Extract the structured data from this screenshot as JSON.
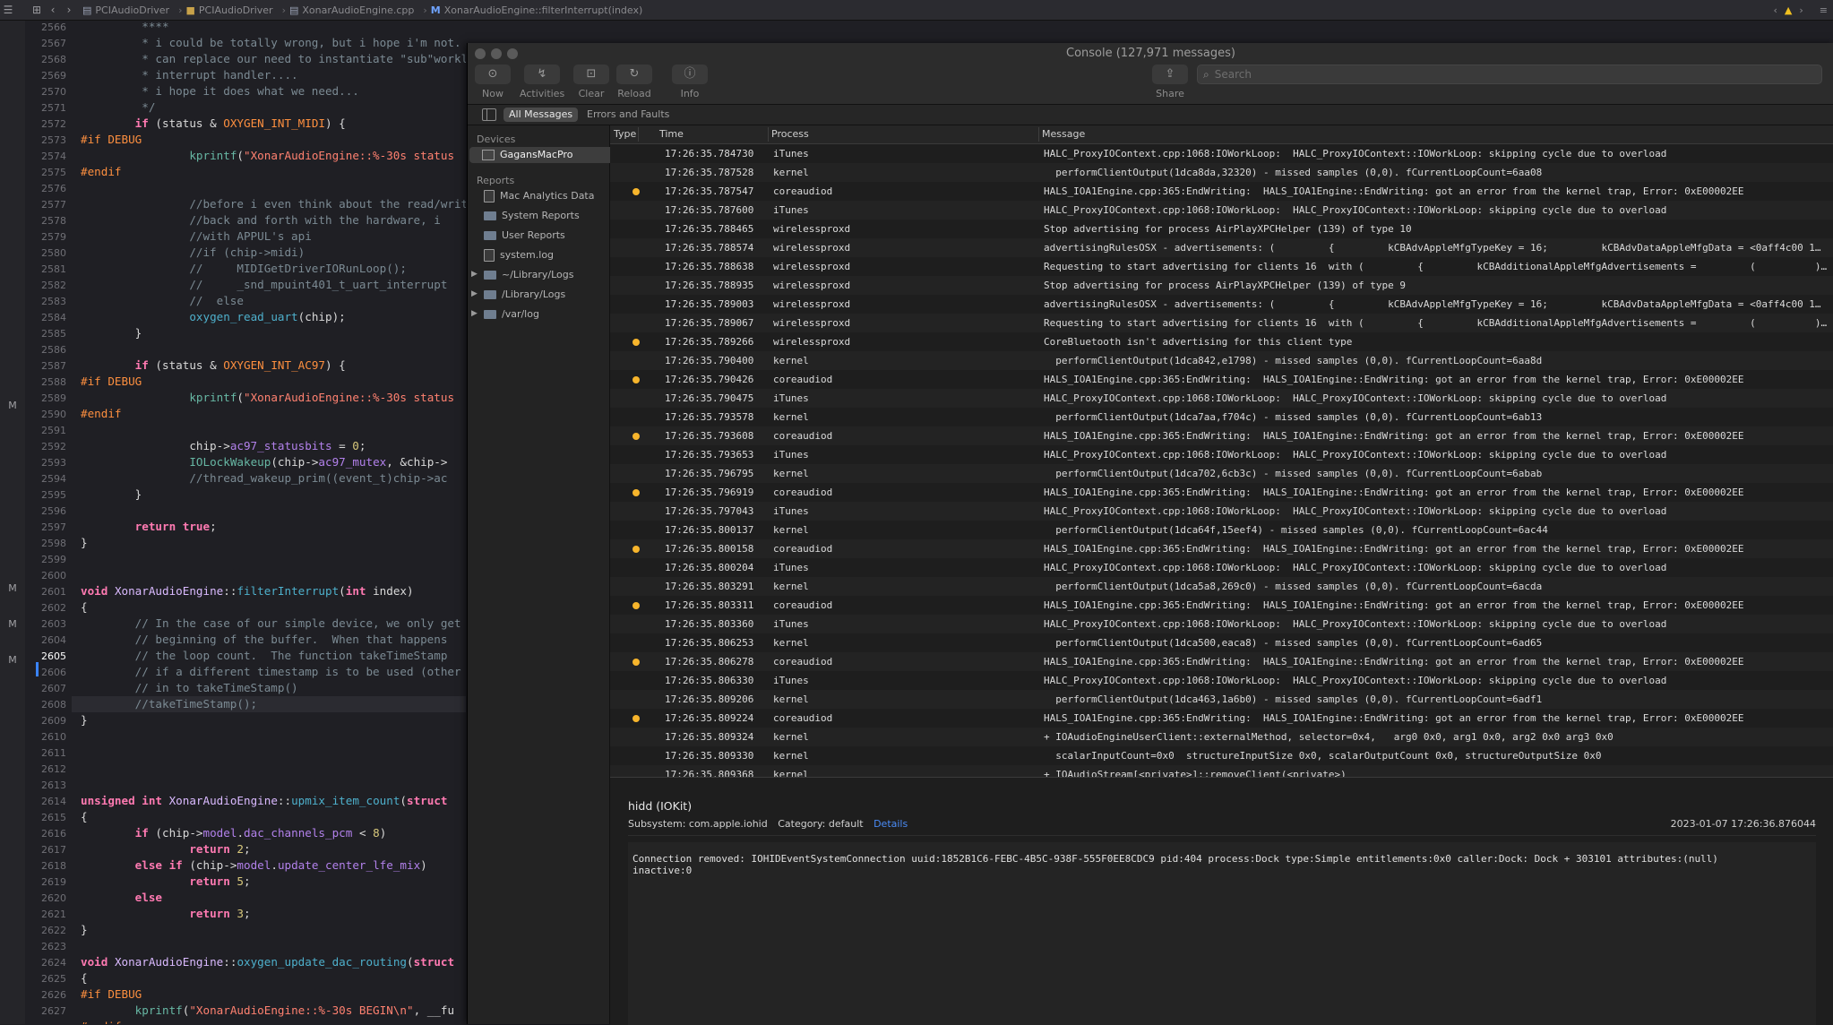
{
  "xcode": {
    "breadcrumbs": [
      "PCIAudioDriver",
      "PCIAudioDriver",
      "XonarAudioEngine.cpp",
      "XonarAudioEngine::filterInterrupt(index)"
    ],
    "gutter_markers": [
      "M",
      "M",
      "M",
      "M"
    ],
    "current_line": "2605",
    "line_numbers": [
      "2566",
      "2567",
      "2568",
      "2569",
      "2570",
      "2571",
      "2572",
      "2573",
      "2574",
      "2575",
      "2576",
      "2577",
      "2578",
      "2579",
      "2580",
      "2581",
      "2582",
      "2583",
      "2584",
      "2585",
      "2586",
      "2587",
      "2588",
      "2589",
      "2590",
      "2591",
      "2592",
      "2593",
      "2594",
      "2595",
      "2596",
      "2597",
      "2598",
      "2599",
      "2600",
      "2601",
      "2602",
      "2603",
      "2604",
      "2605",
      "2606",
      "2607",
      "2608",
      "2609",
      "2610",
      "2611",
      "2612",
      "2613",
      "2614",
      "2615",
      "2616",
      "2617",
      "2618",
      "2619",
      "2620",
      "2621",
      "2622",
      "2623",
      "2624",
      "2625",
      "2626",
      "2627"
    ]
  },
  "console": {
    "title": "Console (127,971 messages)",
    "toolbar": {
      "now": "Now",
      "activities": "Activities",
      "clear": "Clear",
      "reload": "Reload",
      "info": "Info",
      "share": "Share",
      "search_placeholder": "Search"
    },
    "filters": {
      "all_messages": "All Messages",
      "errors_and_faults": "Errors and Faults"
    },
    "sidebar": {
      "devices_header": "Devices",
      "device": "GagansMacPro",
      "reports_header": "Reports",
      "reports": [
        "Mac Analytics Data",
        "System Reports",
        "User Reports",
        "system.log",
        "~/Library/Logs",
        "/Library/Logs",
        "/var/log"
      ]
    },
    "columns": {
      "type": "Type",
      "time": "Time",
      "process": "Process",
      "message": "Message"
    },
    "rows": [
      {
        "dot": false,
        "time": "17:26:35.784730",
        "process": "iTunes",
        "message": "HALC_ProxyIOContext.cpp:1068:IOWorkLoop:  HALC_ProxyIOContext::IOWorkLoop: skipping cycle due to overload"
      },
      {
        "dot": false,
        "time": "17:26:35.787528",
        "process": "kernel",
        "message": "  performClientOutput(1dca8da,32320) - missed samples (0,0). fCurrentLoopCount=6aa08"
      },
      {
        "dot": true,
        "time": "17:26:35.787547",
        "process": "coreaudiod",
        "message": "HALS_IOA1Engine.cpp:365:EndWriting:  HALS_IOA1Engine::EndWriting: got an error from the kernel trap, Error: 0xE00002EE"
      },
      {
        "dot": false,
        "time": "17:26:35.787600",
        "process": "iTunes",
        "message": "HALC_ProxyIOContext.cpp:1068:IOWorkLoop:  HALC_ProxyIOContext::IOWorkLoop: skipping cycle due to overload"
      },
      {
        "dot": false,
        "time": "17:26:35.788465",
        "process": "wirelessproxd",
        "message": "Stop advertising for process AirPlayXPCHelper (139) of type 10"
      },
      {
        "dot": false,
        "time": "17:26:35.788574",
        "process": "wirelessproxd",
        "message": "advertisingRulesOSX - advertisements: (         {         kCBAdvAppleMfgTypeKey = 16;         kCBAdvDataAppleMfgData = <0aff4c00 1…"
      },
      {
        "dot": false,
        "time": "17:26:35.788638",
        "process": "wirelessproxd",
        "message": "Requesting to start advertising for clients 16  with (         {         kCBAdditionalAppleMfgAdvertisements =         (          )…"
      },
      {
        "dot": false,
        "time": "17:26:35.788935",
        "process": "wirelessproxd",
        "message": "Stop advertising for process AirPlayXPCHelper (139) of type 9"
      },
      {
        "dot": false,
        "time": "17:26:35.789003",
        "process": "wirelessproxd",
        "message": "advertisingRulesOSX - advertisements: (         {         kCBAdvAppleMfgTypeKey = 16;         kCBAdvDataAppleMfgData = <0aff4c00 1…"
      },
      {
        "dot": false,
        "time": "17:26:35.789067",
        "process": "wirelessproxd",
        "message": "Requesting to start advertising for clients 16  with (         {         kCBAdditionalAppleMfgAdvertisements =         (          )…"
      },
      {
        "dot": true,
        "time": "17:26:35.789266",
        "process": "wirelessproxd",
        "message": "CoreBluetooth isn't advertising for this client type"
      },
      {
        "dot": false,
        "time": "17:26:35.790400",
        "process": "kernel",
        "message": "  performClientOutput(1dca842,e1798) - missed samples (0,0). fCurrentLoopCount=6aa8d"
      },
      {
        "dot": true,
        "time": "17:26:35.790426",
        "process": "coreaudiod",
        "message": "HALS_IOA1Engine.cpp:365:EndWriting:  HALS_IOA1Engine::EndWriting: got an error from the kernel trap, Error: 0xE00002EE"
      },
      {
        "dot": false,
        "time": "17:26:35.790475",
        "process": "iTunes",
        "message": "HALC_ProxyIOContext.cpp:1068:IOWorkLoop:  HALC_ProxyIOContext::IOWorkLoop: skipping cycle due to overload"
      },
      {
        "dot": false,
        "time": "17:26:35.793578",
        "process": "kernel",
        "message": "  performClientOutput(1dca7aa,f704c) - missed samples (0,0). fCurrentLoopCount=6ab13"
      },
      {
        "dot": true,
        "time": "17:26:35.793608",
        "process": "coreaudiod",
        "message": "HALS_IOA1Engine.cpp:365:EndWriting:  HALS_IOA1Engine::EndWriting: got an error from the kernel trap, Error: 0xE00002EE"
      },
      {
        "dot": false,
        "time": "17:26:35.793653",
        "process": "iTunes",
        "message": "HALC_ProxyIOContext.cpp:1068:IOWorkLoop:  HALC_ProxyIOContext::IOWorkLoop: skipping cycle due to overload"
      },
      {
        "dot": false,
        "time": "17:26:35.796795",
        "process": "kernel",
        "message": "  performClientOutput(1dca702,6cb3c) - missed samples (0,0). fCurrentLoopCount=6abab"
      },
      {
        "dot": true,
        "time": "17:26:35.796919",
        "process": "coreaudiod",
        "message": "HALS_IOA1Engine.cpp:365:EndWriting:  HALS_IOA1Engine::EndWriting: got an error from the kernel trap, Error: 0xE00002EE"
      },
      {
        "dot": false,
        "time": "17:26:35.797043",
        "process": "iTunes",
        "message": "HALC_ProxyIOContext.cpp:1068:IOWorkLoop:  HALC_ProxyIOContext::IOWorkLoop: skipping cycle due to overload"
      },
      {
        "dot": false,
        "time": "17:26:35.800137",
        "process": "kernel",
        "message": "  performClientOutput(1dca64f,15eef4) - missed samples (0,0). fCurrentLoopCount=6ac44"
      },
      {
        "dot": true,
        "time": "17:26:35.800158",
        "process": "coreaudiod",
        "message": "HALS_IOA1Engine.cpp:365:EndWriting:  HALS_IOA1Engine::EndWriting: got an error from the kernel trap, Error: 0xE00002EE"
      },
      {
        "dot": false,
        "time": "17:26:35.800204",
        "process": "iTunes",
        "message": "HALC_ProxyIOContext.cpp:1068:IOWorkLoop:  HALC_ProxyIOContext::IOWorkLoop: skipping cycle due to overload"
      },
      {
        "dot": false,
        "time": "17:26:35.803291",
        "process": "kernel",
        "message": "  performClientOutput(1dca5a8,269c0) - missed samples (0,0). fCurrentLoopCount=6acda"
      },
      {
        "dot": true,
        "time": "17:26:35.803311",
        "process": "coreaudiod",
        "message": "HALS_IOA1Engine.cpp:365:EndWriting:  HALS_IOA1Engine::EndWriting: got an error from the kernel trap, Error: 0xE00002EE"
      },
      {
        "dot": false,
        "time": "17:26:35.803360",
        "process": "iTunes",
        "message": "HALC_ProxyIOContext.cpp:1068:IOWorkLoop:  HALC_ProxyIOContext::IOWorkLoop: skipping cycle due to overload"
      },
      {
        "dot": false,
        "time": "17:26:35.806253",
        "process": "kernel",
        "message": "  performClientOutput(1dca500,eaca8) - missed samples (0,0). fCurrentLoopCount=6ad65"
      },
      {
        "dot": true,
        "time": "17:26:35.806278",
        "process": "coreaudiod",
        "message": "HALS_IOA1Engine.cpp:365:EndWriting:  HALS_IOA1Engine::EndWriting: got an error from the kernel trap, Error: 0xE00002EE"
      },
      {
        "dot": false,
        "time": "17:26:35.806330",
        "process": "iTunes",
        "message": "HALC_ProxyIOContext.cpp:1068:IOWorkLoop:  HALC_ProxyIOContext::IOWorkLoop: skipping cycle due to overload"
      },
      {
        "dot": false,
        "time": "17:26:35.809206",
        "process": "kernel",
        "message": "  performClientOutput(1dca463,1a6b0) - missed samples (0,0). fCurrentLoopCount=6adf1"
      },
      {
        "dot": true,
        "time": "17:26:35.809224",
        "process": "coreaudiod",
        "message": "HALS_IOA1Engine.cpp:365:EndWriting:  HALS_IOA1Engine::EndWriting: got an error from the kernel trap, Error: 0xE00002EE"
      },
      {
        "dot": false,
        "time": "17:26:35.809324",
        "process": "kernel",
        "message": "+ IOAudioEngineUserClient::externalMethod, selector=0x4,   arg0 0x0, arg1 0x0, arg2 0x0 arg3 0x0"
      },
      {
        "dot": false,
        "time": "17:26:35.809330",
        "process": "kernel",
        "message": "  scalarInputCount=0x0  structureInputSize 0x0, scalarOutputCount 0x0, structureOutputSize 0x0"
      },
      {
        "dot": false,
        "time": "17:26:35.809368",
        "process": "kernel",
        "message": "+ IOAudioStream[<private>]::removeClient(<private>)"
      }
    ],
    "detail": {
      "title": "hidd (IOKit)",
      "subsystem": "Subsystem: com.apple.iohid",
      "category": "Category: default",
      "details_link": "Details",
      "date": "2023-01-07 17:26:36.876044",
      "body": "Connection removed: IOHIDEventSystemConnection uuid:1852B1C6-FEBC-4B5C-938F-555F0EE8CDC9 pid:404 process:Dock type:Simple entitlements:0x0 caller:Dock: Dock + 303101 attributes:(null)\ninactive:0"
    }
  }
}
